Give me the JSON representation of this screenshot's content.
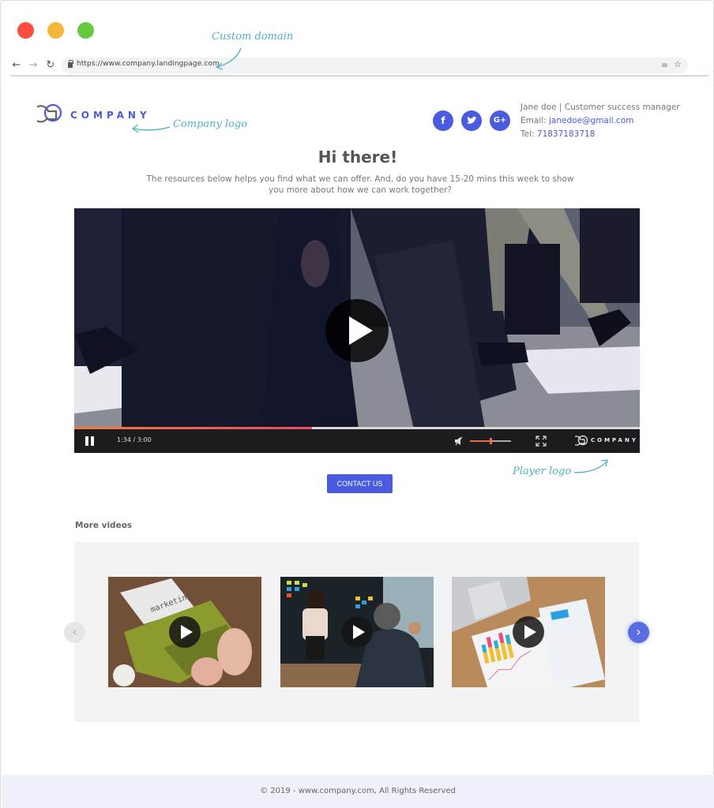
{
  "browser": {
    "url": "https://www.company.landingpage.com",
    "nav": {
      "back_icon": "arrow-left-icon",
      "forward_icon": "arrow-right-icon",
      "reload_icon": "reload-icon"
    },
    "colors": {
      "red": "#fd4d3f",
      "yellow": "#f2b63a",
      "green": "#66c93f"
    }
  },
  "annotations": {
    "custom_domain": "Custom domain",
    "company_logo": "Company logo",
    "player_logo": "Player logo"
  },
  "header": {
    "logo_text": "COMPANY",
    "social": [
      {
        "name": "facebook",
        "glyph": "f"
      },
      {
        "name": "twitter",
        "glyph": "t"
      },
      {
        "name": "google-plus",
        "glyph": "G+"
      }
    ],
    "contact": {
      "name_title": "Jane doe | Customer success manager",
      "email_label": "Email: ",
      "email": "janedoe@gmail.com",
      "tel_label": "Tel: ",
      "tel": "71837183718"
    }
  },
  "hero": {
    "title": "Hi there!",
    "subtitle": "The resources below helps you find what we can offer. And, do you have 15-20 mins this week to show you more about how we can work together?"
  },
  "player": {
    "time": "1:34 / 3:00",
    "progress_percent": 42,
    "volume_percent": 50,
    "logo_text": "COMPANY"
  },
  "cta": {
    "contact_label": "CONTACT US"
  },
  "more_videos": {
    "title": "More videos",
    "items": [
      {
        "subject": "typewriter marketing"
      },
      {
        "subject": "office meeting presentation"
      },
      {
        "subject": "laptop with charts report"
      }
    ]
  },
  "footer": {
    "text": "© 2019 - www.company.com, All Rights Reserved"
  },
  "colors": {
    "accent": "#4a5be0",
    "annotation": "#4eb0c4",
    "footer_bg": "#eef0fa"
  }
}
